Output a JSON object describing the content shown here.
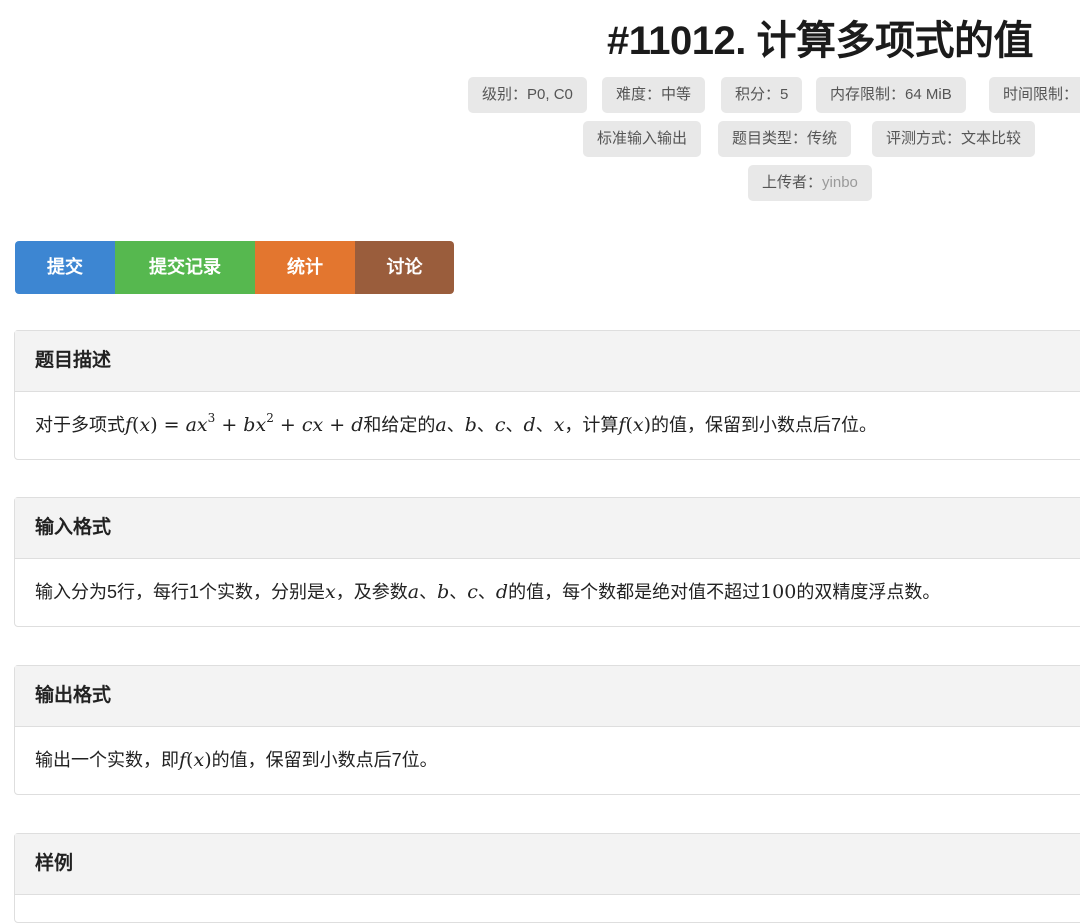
{
  "problem": {
    "title": "#11012. 计算多项式的值"
  },
  "labels": {
    "level": {
      "key": "级别：",
      "value": "P0, C0"
    },
    "difficulty": {
      "key": "难度：",
      "value": "中等"
    },
    "score": {
      "key": "积分：",
      "value": "5"
    },
    "memory": {
      "key": "内存限制：",
      "value": "64 MiB"
    },
    "time": {
      "key": "时间限制：",
      "value": ""
    },
    "io": {
      "text": "标准输入输出"
    },
    "type": {
      "key": "题目类型：",
      "value": "传统"
    },
    "judge": {
      "key": "评测方式：",
      "value": "文本比较"
    },
    "uploader": {
      "key": "上传者：",
      "value": "yinbo"
    }
  },
  "actions": {
    "submit": "提交",
    "records": "提交记录",
    "stats": "统计",
    "discuss": "讨论"
  },
  "colors": {
    "submit": "#3d86d2",
    "records": "#56b84f",
    "stats": "#e3762f",
    "discuss": "#9a5d3c"
  },
  "sections": {
    "description": {
      "heading": "题目描述",
      "t1": "对于多项式",
      "t2": "和给定的",
      "t3": "，计算",
      "t4": "的值，保留到小数点后7位。"
    },
    "input": {
      "heading": "输入格式",
      "t1": "输入分为5行，每行1个实数，分别是",
      "t2": "，及参数",
      "t3": "的值，每个数都是绝对值不超过",
      "num": "100",
      "t4": "的双精度浮点数。"
    },
    "output": {
      "heading": "输出格式",
      "t1": "输出一个实数，即",
      "t2": "的值，保留到小数点后7位。"
    },
    "sample": {
      "heading": "样例"
    }
  }
}
